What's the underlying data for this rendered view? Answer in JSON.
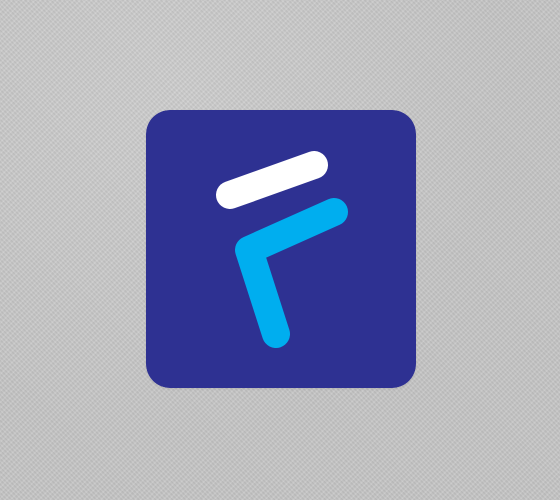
{
  "logo": {
    "icon": "f-logo-icon",
    "colors": {
      "background": "#c9c9c9",
      "tile": "#2e3192",
      "top_stroke": "#ffffff",
      "bottom_stroke": "#00aeef"
    }
  }
}
